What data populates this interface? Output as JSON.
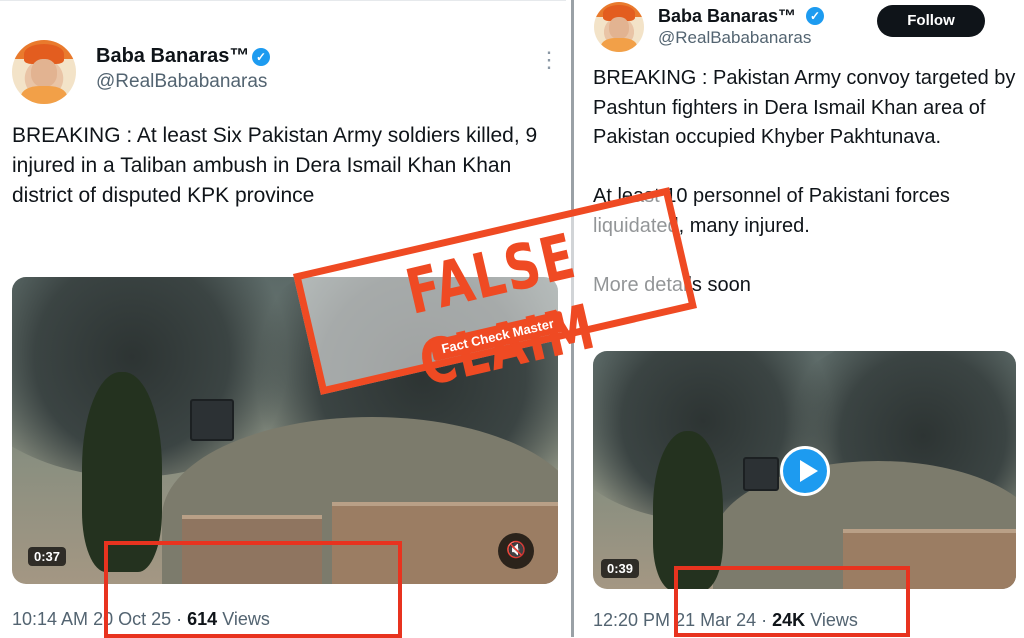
{
  "left_tweet": {
    "author_name": "Baba Banaras™",
    "author_handle": "@RealBababanaras",
    "text": "BREAKING : At least Six Pakistan Army soldiers killed, 9 injured in a Taliban ambush in Dera Ismail Khan Khan district of disputed KPK province",
    "video_duration": "0:37",
    "time": "10:14 AM",
    "date": "20 Oct 25",
    "views_count": "614",
    "views_label": "Views",
    "separator": "·"
  },
  "right_tweet": {
    "author_name": "Baba Banaras™",
    "author_handle": "@RealBababanaras",
    "follow_label": "Follow",
    "text": "BREAKING : Pakistan Army convoy targeted by Pashtun fighters in Dera Ismail Khan area of Pakistan occupied Khyber Pakhtunava.\n\nAt least 10 personnel of Pakistani forces liquidated, many injured.\n\nMore details soon",
    "video_duration": "0:39",
    "time": "12:20 PM",
    "date": "21 Mar 24",
    "views_count": "24K",
    "views_label": "Views",
    "separator": "·"
  },
  "stamp": {
    "title": "FALSE CLAIM",
    "ribbon": "Fact Check Master"
  },
  "colors": {
    "verified": "#1d9bf0",
    "stamp": "#ef4a23",
    "highlight_box": "#e8331f"
  },
  "icons": {
    "verified": "verified-badge-icon",
    "more": "more-options-icon",
    "mute": "mute-icon",
    "play": "play-icon"
  }
}
